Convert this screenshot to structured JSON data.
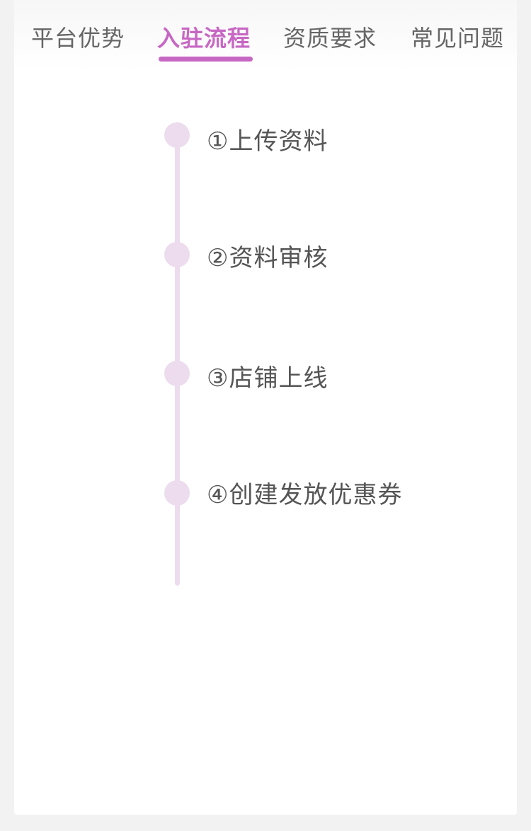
{
  "tabs": [
    {
      "label": "平台优势"
    },
    {
      "label": "入驻流程"
    },
    {
      "label": "资质要求"
    },
    {
      "label": "常见问题"
    }
  ],
  "active_tab": "入驻流程",
  "accent_color": "#c767c4",
  "timeline_color": "#ecdcee",
  "steps": [
    {
      "label": "①上传资料"
    },
    {
      "label": "②资料审核"
    },
    {
      "label": "③店铺上线"
    },
    {
      "label": "④创建发放优惠券"
    }
  ]
}
